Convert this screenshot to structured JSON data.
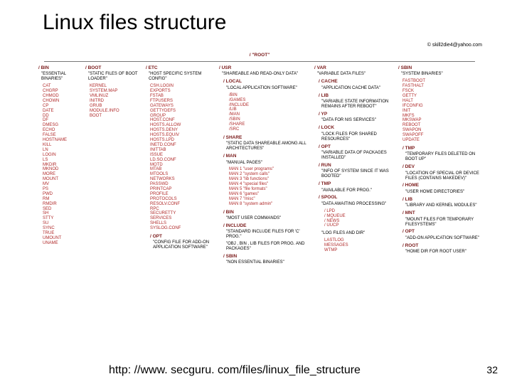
{
  "title": "Linux files structure",
  "footer": {
    "url": "http: //www. secguru. com/files/linux_file_structure",
    "page": "32"
  },
  "diagram": {
    "credit": "© skill2die4@yahoo.com",
    "root": "/  \"ROOT\"",
    "columns": [
      {
        "el": "col-bin",
        "header": "/ BIN",
        "desc": "\"ESSENTIAL BINARIES\"",
        "items": [
          "CAT",
          "CHGRP",
          "CHMOD",
          "CHOWN",
          "CP",
          "DATE",
          "DD",
          "DF",
          "DMESG",
          "ECHO",
          "FALSE",
          "HOSTNAME",
          "KILL",
          "LN",
          "LOGIN",
          "LS",
          "MKDIR",
          "MKNOD",
          "MORE",
          "MOUNT",
          "MV",
          "PS",
          "PWD",
          "RM",
          "RMDIR",
          "SED",
          "SH",
          "STTY",
          "SU",
          "SYNC",
          "TRUE",
          "UMOUNT",
          "UNAME"
        ]
      },
      {
        "el": "col-boot",
        "header": "/ BOOT",
        "desc": "\"STATIC FILES OF BOOT LOADER\"",
        "items": [
          "KERNEL",
          "SYSTEM.MAP",
          "VMLINUZ",
          "INITRD",
          "GRUB",
          "MODULE.INFO",
          "BOOT"
        ]
      },
      {
        "el": "col-etc",
        "header": "/ ETC",
        "desc": "\"HOST SPECIFIC SYSTEM CONFIG\"",
        "items": [
          "CSH.LOGIN",
          "EXPORTS",
          "FSTAB",
          "FTPUSERS",
          "GATEWAYS",
          "GETTYDEFS",
          "GROUP",
          "HOST.CONF",
          "HOSTS.ALLOW",
          "HOSTS.DENY",
          "HOSTS.EQUIV",
          "HOSTS.LPD",
          "INETD.CONF",
          "INITTAB",
          "ISSUE",
          "LD.SO.CONF",
          "MOTD",
          "MTAB",
          "MTOOLS",
          "NETWORKS",
          "PASSWD",
          "PRINTCAP",
          "PROFILE",
          "PROTOCOLS",
          "RESOLV.CONF",
          "RPC",
          "SECURETTY",
          "SERVICES",
          "SHELLS",
          "SYSLOG.CONF"
        ],
        "subs": [
          {
            "header": "/ OPT",
            "desc": "\"CONFIG FILE FOR ADD-ON APPLICATION SOFTWARE\""
          }
        ]
      },
      {
        "el": "col-usr",
        "header": "/ USR",
        "desc": "\"SHAREABLE AND READ-ONLY DATA\"",
        "subs": [
          {
            "header": "/ LOCAL",
            "desc": "\"LOCAL APPLICATION SOFTWARE\"",
            "items": [
              "/BIN",
              "/GAMES",
              "/INCLUDE",
              "/LIB",
              "/MAN",
              "/SBIN",
              "/SHARE",
              "/SRC"
            ]
          },
          {
            "header": "/ SHARE",
            "desc": "\"STATIC DATA SHAREABLE AMONG ALL ARCHITECTURES\""
          },
          {
            "header": "/ MAN",
            "desc": "\"MANUAL PAGES\"",
            "items": [
              "MAN 1 \"user programs\"",
              "MAN 2 \"system calls\"",
              "MAN 3 \"lib functions\"",
              "MAN 4 \"special files\"",
              "MAN 5 \"file formats\"",
              "MAN 6 \"games\"",
              "MAN 7 \"misc\"",
              "MAN 8 \"system admin\""
            ]
          },
          {
            "header": "/ BIN",
            "desc": "\"MOST USER COMMANDS\""
          },
          {
            "header": "/ INCLUDE",
            "desc": "\"STANDARD INCLUDE FILES FOR 'C' PROG.\""
          },
          {
            "header": "",
            "desc": "\"OBJ , BIN , LIB FILES FOR PROG. AND PACKAGES\""
          },
          {
            "header": "/ SBIN",
            "desc": "\"NON ESSENTIAL BINARIES\""
          }
        ]
      },
      {
        "el": "col-var",
        "header": "/ VAR",
        "desc": "\"VARIABLE DATA FILES\"",
        "subs": [
          {
            "header": "/ CACHE",
            "desc": "\"APPLICATION CACHE DATA\""
          },
          {
            "header": "/ LIB",
            "desc": "\"VARIABLE STATE INFORMATION REMAINS AFTER REBOOT\""
          },
          {
            "header": "/ YP",
            "desc": "\"DATA FOR NIS SERVICES\""
          },
          {
            "header": "/ LOCK",
            "desc": "\"LOCK FILES FOR SHARED RESOURCES\""
          },
          {
            "header": "/ OPT",
            "desc": "\"VARIABLE DATA OF PACKAGES INSTALLED\""
          },
          {
            "header": "/ RUN",
            "desc": "\"INFO OF SYSTEM SINCE IT WAS BOOTED\""
          },
          {
            "header": "/ TMP",
            "desc": "\"AVAILABLE FOR PROG.\""
          },
          {
            "header": "/ SPOOL",
            "desc": "\"DATA AWAITING PROCESSING\"",
            "items": [
              "/ LPD",
              "/ MQUEUE",
              "/ NEWS",
              "/ UUCP"
            ]
          },
          {
            "header": "",
            "desc": "\"LOG FILES AND DIR\"",
            "items": [
              "LASTLOG",
              "MESSAGES",
              "WTMP"
            ]
          }
        ]
      },
      {
        "el": "col-sbin",
        "header": "/ SBIN",
        "desc": "\"SYSTEM BINARIES\"",
        "items": [
          "FASTBOOT",
          "FASTHALT",
          "FSCK",
          "GETTY",
          "HALT",
          "IFCONFIG",
          "INIT",
          "MKFS",
          "MKSWAP",
          "REBOOT",
          "SWAPON",
          "SWAPOFF",
          "UPDATE"
        ],
        "subs": [
          {
            "header": "/ TMP",
            "desc": "\"TEMPORARY FILES DELETED ON BOOT UP\""
          },
          {
            "header": "/ DEV",
            "desc": "\"LOCATION OF SPECIAL OR DEVICE FILES (CONTAINS MAKEDEV)\""
          },
          {
            "header": "/ HOME",
            "desc": "\"USER HOME DIRECTORIES\""
          },
          {
            "header": "/ LIB",
            "desc": "\"LIBRARY AND KERNEL MODULES\""
          },
          {
            "header": "/ MNT",
            "desc": "\"MOUNT FILES FOR TEMPORARY FILESYSTEMS\""
          },
          {
            "header": "/ OPT",
            "desc": "\"ADD-ON APPLICATION SOFTWARE\""
          },
          {
            "header": "/ ROOT",
            "desc": "\"HOME DIR FOR ROOT USER\""
          }
        ]
      }
    ]
  }
}
